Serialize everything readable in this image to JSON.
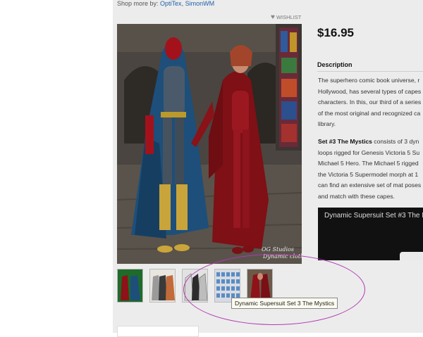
{
  "shop_more": {
    "label": "Shop more by:",
    "vendor1": "OptiTex",
    "separator": ",",
    "vendor2": "SimonWM"
  },
  "wishlist": {
    "label": "WISHLIST"
  },
  "product": {
    "price": "$16.95",
    "description_heading": "Description",
    "description_lines": [
      "The superhero comic book universe, r",
      "Hollywood, has several types of capes",
      "characters. In this, our third of a series",
      "of the most original and recognized ca",
      "library."
    ],
    "set_label": "Set #3 The Mystics",
    "set_first_line_rest": " consists of 3 dyn",
    "set_lines": [
      "loops rigged for Genesis Victoria 5 Su",
      "Michael 5 Hero. The Michael 5 rigged",
      "the Victoria 5 Supermodel morph at 1",
      "can find an extensive set of mat poses",
      "and match with these capes."
    ]
  },
  "image": {
    "watermark_line1": "OG Studios",
    "watermark_line2": "Dynamic cloth"
  },
  "video": {
    "title": "Dynamic Supersuit Set #3 The M"
  },
  "thumbnails": [
    {
      "name": "thumb-1"
    },
    {
      "name": "thumb-2"
    },
    {
      "name": "thumb-3"
    },
    {
      "name": "thumb-4"
    },
    {
      "name": "thumb-5"
    }
  ],
  "tooltip": {
    "text": "Dynamic Supersuit Set 3 The Mystics"
  },
  "colors": {
    "link": "#1f5fa8",
    "annotation": "#b03ab3",
    "cape_blue": "#1d4f7a",
    "cape_red": "#8e1218"
  }
}
